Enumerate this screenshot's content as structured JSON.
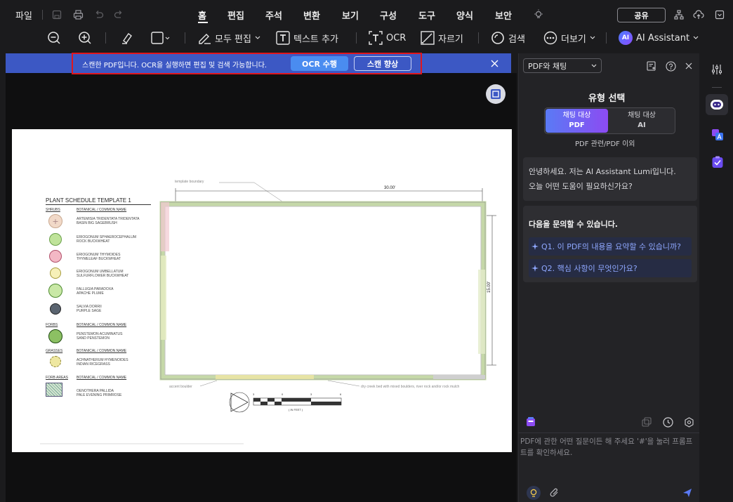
{
  "menubar": {
    "file": "파일",
    "tabs": [
      "홈",
      "편집",
      "주석",
      "변환",
      "보기",
      "구성",
      "도구",
      "양식",
      "보안"
    ],
    "active_tab": "홈",
    "share": "공유"
  },
  "toolbar": {
    "edit_all": "모두 편집",
    "add_text": "텍스트 추가",
    "ocr": "OCR",
    "crop": "자르기",
    "search": "검색",
    "more": "더보기",
    "ai_assistant": "AI Assistant",
    "ai_badge": "AI"
  },
  "banner": {
    "message": "스캔한 PDF입니다. OCR을 실행하면 편집 및 검색 가능합니다.",
    "ocr_button": "OCR 수행",
    "enhance_button": "스캔 향상"
  },
  "document": {
    "title": "PLANT SCHEDULE TEMPLATE 1",
    "template_boundary": "template boundary",
    "width_dim": "30.00'",
    "height_dim": "15.00'",
    "accent_boulder": "accent boulder",
    "creek_note": "dry creek bed with mixed boulders, river rock and/or rock mulch",
    "scale_label": "( IN FEET )",
    "scale_ticks": [
      "3",
      "0",
      "3",
      "6"
    ],
    "sections": [
      {
        "name": "SHRUBS",
        "header": "BOTANICAL / COMMON NAME",
        "items": [
          {
            "l1": "ARTEMISIA TRIDENTATA TRIDENTATA",
            "l2": "BASIN BIG SAGEBRUSH"
          },
          {
            "l1": "ERIOGONUM SPHAEROCEPHALUM",
            "l2": "ROCK BUCKWHEAT"
          },
          {
            "l1": "ERIOGONUM THYMOIDES",
            "l2": "THYMELEAF BUCKWHEAT"
          },
          {
            "l1": "ERIOGONUM UMBELLATUM",
            "l2": "SULFURFLOWER BUCKWHEAT"
          },
          {
            "l1": "FALLUGIA PARADOXA",
            "l2": "APACHE PLUME"
          },
          {
            "l1": "SALVIA DORRII",
            "l2": "PURPLE SAGE"
          }
        ]
      },
      {
        "name": "FORBS",
        "header": "BOTANICAL / COMMON NAME",
        "items": [
          {
            "l1": "PENSTEMON ACUMINATUS",
            "l2": "SAND PENSTEMON"
          }
        ]
      },
      {
        "name": "GRASSES",
        "header": "BOTANICAL / COMMON NAME",
        "items": [
          {
            "l1": "ACHNATHERUM HYMENOIDES",
            "l2": "INDIAN RICEGRASS"
          }
        ]
      },
      {
        "name": "FORB AREAS",
        "header": "BOTANICAL / COMMON NAME",
        "items": [
          {
            "l1": "OENOTHERA PALLIDA",
            "l2": "PALE EVENING PRIMROSE"
          }
        ]
      }
    ]
  },
  "panel": {
    "mode_select": "PDF와 채팅",
    "type_title": "유형 선택",
    "chat_pdf_l1": "채팅 대상",
    "chat_pdf_l2": "PDF",
    "chat_ai_l1": "채팅 대상",
    "chat_ai_l2": "AI",
    "scope_note": "PDF 관련/PDF 이외",
    "greeting_l1": "안녕하세요. 저는 AI Assistant Lumi입니다.",
    "greeting_l2": "오늘 어떤 도움이 필요하신가요?",
    "suggest_title": "다음을 문의할 수 있습니다.",
    "q1": "Q1. 이 PDF의 내용을 요약할 수 있습니까?",
    "q2": "Q2. 핵심 사항이 무엇인가요?",
    "input_placeholder": "PDF에 관한 어떤 질문이든 해 주세요 '#'을 눌러 프롬프트를 확인하세요."
  },
  "colors": {
    "accent": "#3c58c4",
    "highlight_box": "#e0161d",
    "ocr_button": "#4a8cf0",
    "link": "#8fa8ff"
  }
}
